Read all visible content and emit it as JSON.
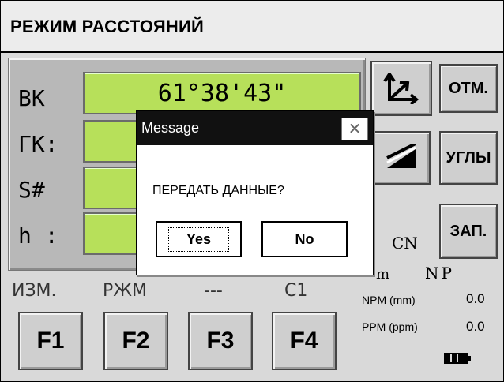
{
  "header": {
    "title": "РЕЖИМ РАССТОЯНИЙ"
  },
  "rows": [
    {
      "label": "ВК",
      "value": "61°38'43\""
    },
    {
      "label": "ГК:",
      "value": ""
    },
    {
      "label": "S#",
      "value": ""
    },
    {
      "label": "h :",
      "value": ""
    }
  ],
  "right_buttons": {
    "otm": "ОТМ.",
    "ugly": "УГЛЫ",
    "zap": "ЗАП."
  },
  "icons": {
    "coords": "axes-icon",
    "slope": "slope-icon",
    "battery": "battery-icon"
  },
  "fkeys": [
    {
      "caption": "ИЗМ.",
      "label": "F1"
    },
    {
      "caption": "РЖМ",
      "label": "F2"
    },
    {
      "caption": "---",
      "label": "F3"
    },
    {
      "caption": "C1",
      "label": "F4"
    }
  ],
  "status": {
    "cn": "CN",
    "unit": "m",
    "np": "NP",
    "npm_label": "NPM (mm)",
    "npm_value": "0.0",
    "ppm_label": "PPM (ppm)",
    "ppm_value": "0.0"
  },
  "dialog": {
    "title": "Message",
    "close": "✕",
    "message": "ПЕРЕДАТЬ ДАННЫЕ?",
    "yes_first": "Y",
    "yes_rest": "es",
    "no_first": "N",
    "no_rest": "o"
  }
}
